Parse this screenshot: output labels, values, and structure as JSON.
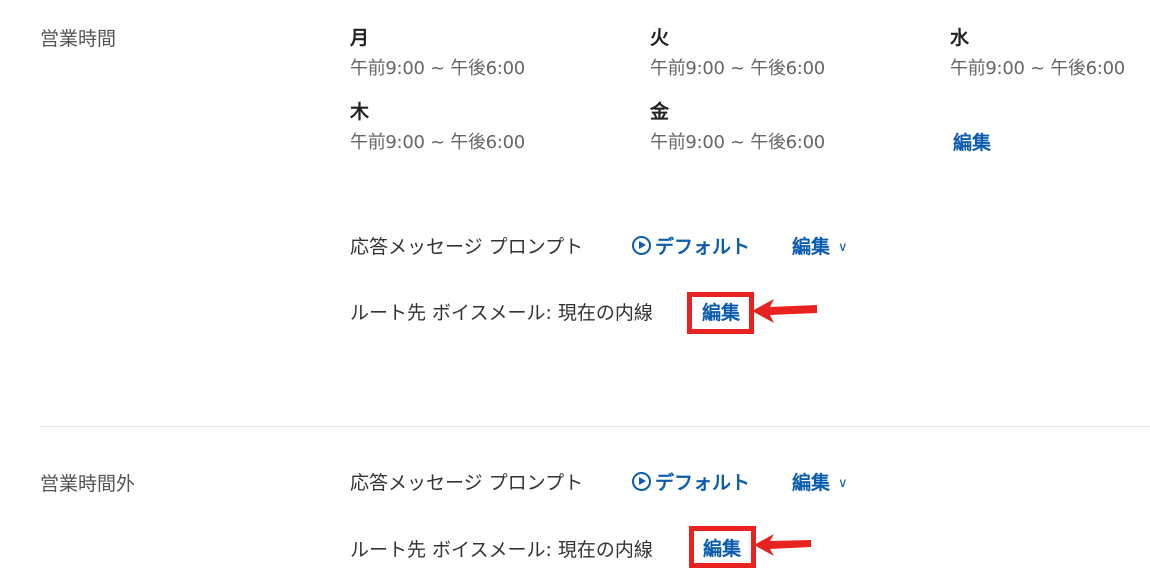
{
  "business_hours": {
    "label": "営業時間",
    "days": [
      {
        "name": "月",
        "hours": "午前9:00 ~ 午後6:00"
      },
      {
        "name": "火",
        "hours": "午前9:00 ~ 午後6:00"
      },
      {
        "name": "水",
        "hours": "午前9:00 ~ 午後6:00"
      },
      {
        "name": "木",
        "hours": "午前9:00 ~ 午後6:00"
      },
      {
        "name": "金",
        "hours": "午前9:00 ~ 午後6:00"
      }
    ],
    "edit_hours_label": "編集",
    "greeting": {
      "label": "応答メッセージ プロンプト",
      "default_label": "デフォルト",
      "edit_label": "編集"
    },
    "route": {
      "label": "ルート先 ボイスメール: 現在の内線",
      "edit_label": "編集"
    }
  },
  "after_hours": {
    "label": "営業時間外",
    "greeting": {
      "label": "応答メッセージ プロンプト",
      "default_label": "デフォルト",
      "edit_label": "編集"
    },
    "route": {
      "label": "ルート先 ボイスメール: 現在の内線",
      "edit_label": "編集"
    }
  },
  "colors": {
    "link": "#0b5cad",
    "annotation": "#e8221f"
  },
  "icons": {
    "play": "play-circle-icon",
    "chevron": "chevron-down-icon",
    "arrow": "red-arrow-annotation"
  }
}
